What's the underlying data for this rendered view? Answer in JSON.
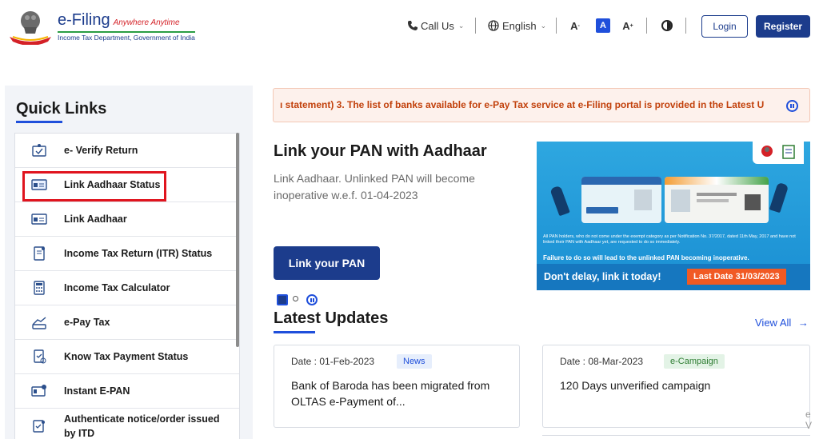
{
  "header": {
    "logo_title": "e-Filing",
    "logo_tagline": "Anywhere Anytime",
    "logo_subtitle": "Income Tax Department, Government of India",
    "call_us": "Call Us",
    "language": "English",
    "font_decrease": "A",
    "font_default": "A",
    "font_increase": "A",
    "login": "Login",
    "register": "Register"
  },
  "quick_links": {
    "title": "Quick Links",
    "items": [
      {
        "label": "e- Verify Return",
        "icon": "verify-return-icon"
      },
      {
        "label": "Link Aadhaar Status",
        "icon": "aadhaar-card-icon"
      },
      {
        "label": "Link Aadhaar",
        "icon": "aadhaar-link-icon"
      },
      {
        "label": "Income Tax Return (ITR) Status",
        "icon": "itr-document-icon"
      },
      {
        "label": "Income Tax Calculator",
        "icon": "calculator-icon"
      },
      {
        "label": "e-Pay Tax",
        "icon": "pay-tax-icon"
      },
      {
        "label": "Know Tax Payment Status",
        "icon": "payment-status-icon"
      },
      {
        "label": "Instant E-PAN",
        "icon": "pan-card-icon"
      },
      {
        "label": "Authenticate notice/order issued by ITD",
        "icon": "authenticate-notice-icon"
      }
    ]
  },
  "marquee": {
    "text": "ı statement) 3. The list of banks available for e-Pay Tax service at e-Filing portal is provided in the Latest U"
  },
  "pan_section": {
    "heading": "Link your PAN with Aadhaar",
    "description": "Link Aadhaar. Unlinked PAN will become inoperative w.e.f. 01-04-2023",
    "button": "Link your PAN"
  },
  "banner": {
    "fine_print": "All PAN holders, who do not come under the exempt category as per Notification No. 37/2017, dated 11th May, 2017 and have not linked their PAN with Aadhaar yet, are requested to do so immediately.",
    "warning": "Failure to do so will lead to the unlinked PAN becoming inoperative.",
    "cta": "Don't delay, link it today!",
    "last_date": "Last Date 31/03/2023"
  },
  "latest_updates": {
    "title": "Latest Updates",
    "view_all": "View All",
    "cards": [
      {
        "date": "Date : 01-Feb-2023",
        "badge": "News",
        "title": "Bank of Baroda has been migrated from OLTAS e-Payment of..."
      },
      {
        "date": "Date : 08-Mar-2023",
        "badge": "e-Campaign",
        "title": "120 Days unverified campaign"
      }
    ],
    "edge_text": "e V"
  },
  "colors": {
    "brand": "#1c3c8c",
    "accent": "#1f4fdb",
    "highlight": "#e0141e",
    "marquee_text": "#c2410c"
  }
}
